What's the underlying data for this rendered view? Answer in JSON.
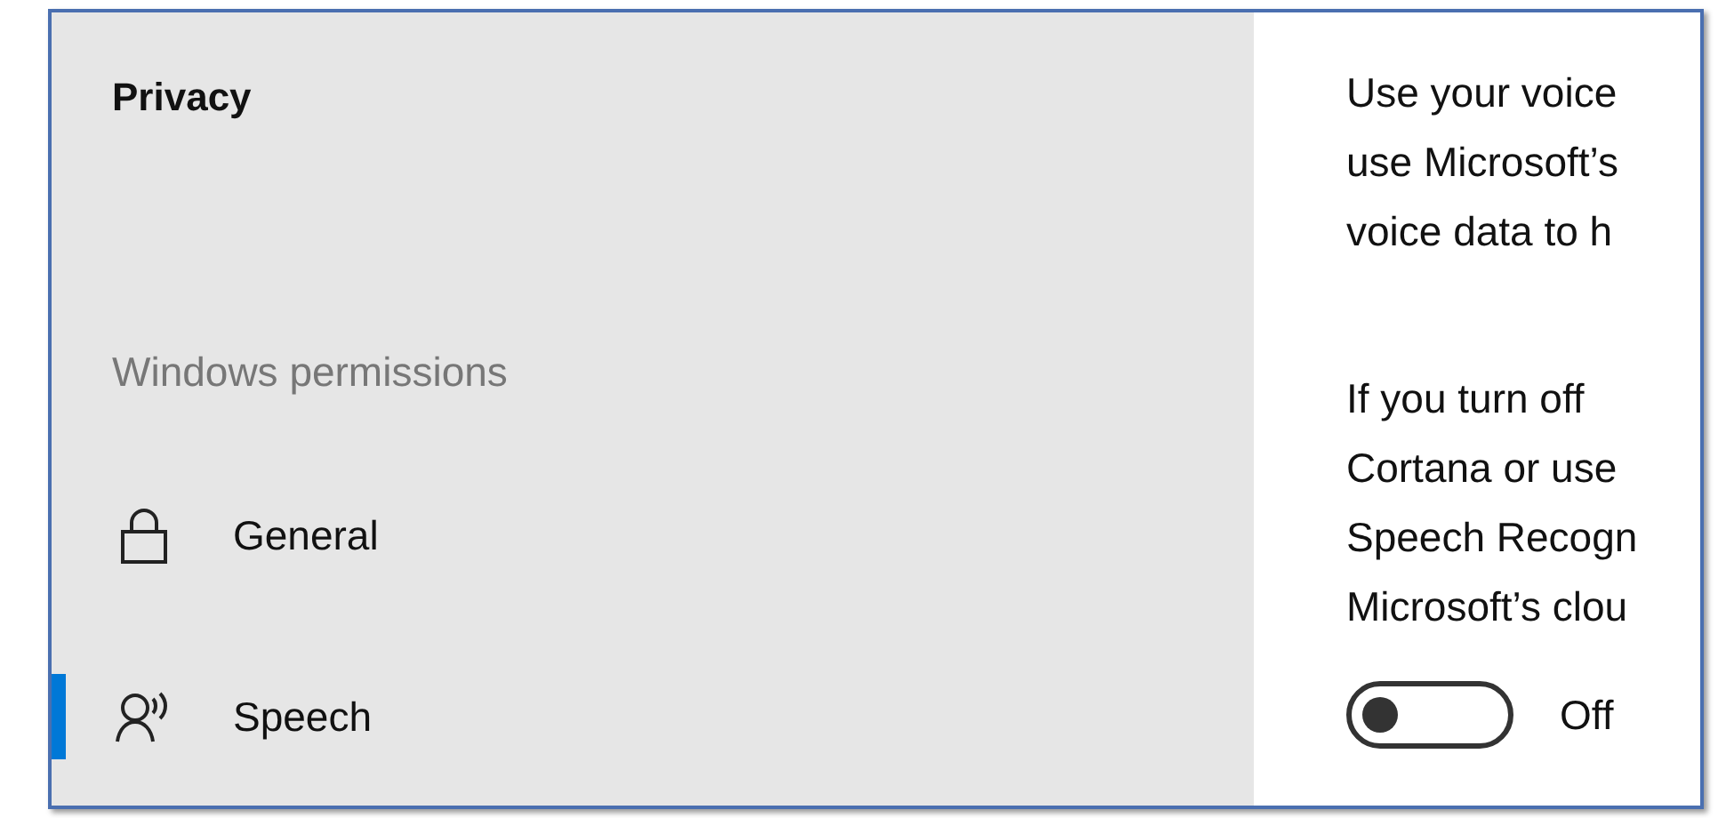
{
  "sidebar": {
    "title": "Privacy",
    "section": "Windows permissions",
    "items": [
      {
        "label": "General",
        "selected": false
      },
      {
        "label": "Speech",
        "selected": true
      }
    ]
  },
  "content": {
    "paragraphs": [
      "Use your voice\nuse Microsoft’s\nvoice data to h",
      "If you turn off\nCortana or use\nSpeech Recogn\nMicrosoft’s clou"
    ],
    "toggle": {
      "on": false,
      "label": "Off"
    }
  }
}
